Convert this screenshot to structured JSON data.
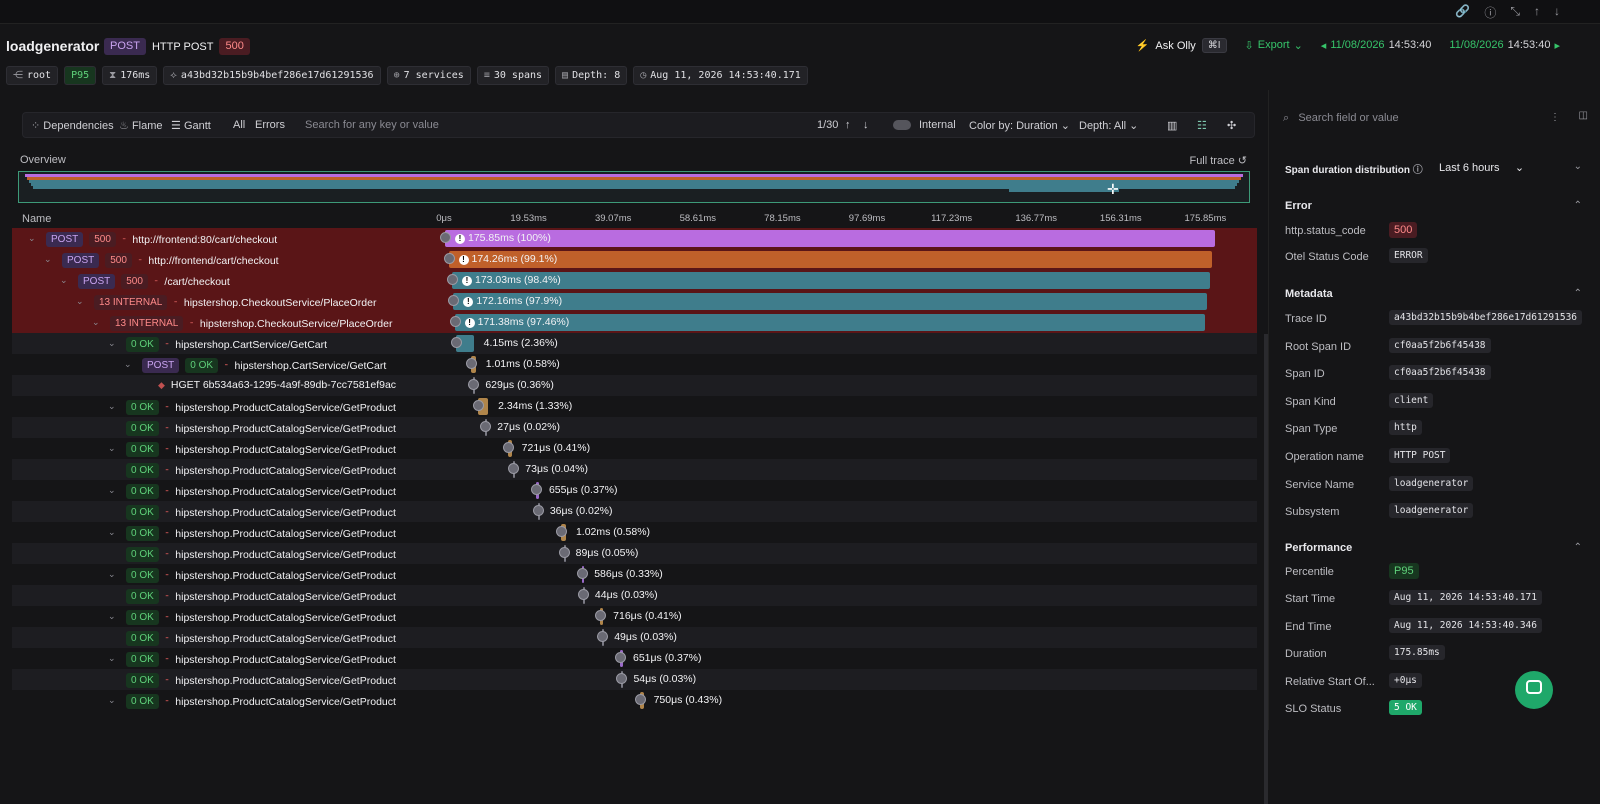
{
  "topicons": [
    "link-icon",
    "info-icon",
    "collapse-icon",
    "arrow-up-icon",
    "arrow-down-icon"
  ],
  "header": {
    "title": "loadgenerator",
    "method": "POST",
    "operation": "HTTP POST",
    "status": "500",
    "ask_olly": "Ask Olly",
    "ask_kbd": "⌘I",
    "export": "Export",
    "date_from": "11/08/2026",
    "time_from": "14:53:40",
    "date_to": "11/08/2026",
    "time_to": "14:53:40"
  },
  "chips": {
    "root": "root",
    "percentile": "P95",
    "duration": "176ms",
    "trace_id": "a43bd32b15b9b4bef286e17d61291536",
    "services": "7 services",
    "spans": "30 spans",
    "depth": "Depth: 8",
    "time": "Aug 11, 2026 14:53:40.171"
  },
  "toolbar": {
    "dependencies": "Dependencies",
    "flame": "Flame",
    "gantt": "Gantt",
    "all": "All",
    "errors": "Errors",
    "search_placeholder": "Search for any key or value",
    "counter": "1/30",
    "internal": "Internal",
    "color_by": "Color by: Duration",
    "depth": "Depth: All"
  },
  "overview": {
    "label": "Overview",
    "full_trace": "Full trace"
  },
  "columns": {
    "name": "Name"
  },
  "ticks": [
    "0μs",
    "19.53ms",
    "39.07ms",
    "58.61ms",
    "78.15ms",
    "97.69ms",
    "117.23ms",
    "136.77ms",
    "156.31ms",
    "175.85ms"
  ],
  "spans": [
    {
      "depth": 0,
      "caret": true,
      "badges": [
        [
          "POST",
          "post"
        ],
        [
          "500",
          "500"
        ]
      ],
      "name": "http://frontend:80/cart/checkout",
      "start": 0,
      "dur": 175.85,
      "label": "175.85ms (100%)",
      "color": "#b96ce0",
      "err": true,
      "exc": true
    },
    {
      "depth": 1,
      "caret": true,
      "badges": [
        [
          "POST",
          "post"
        ],
        [
          "500",
          "500"
        ]
      ],
      "name": "http://frontend/cart/checkout",
      "start": 0.8,
      "dur": 174.26,
      "label": "174.26ms (99.1%)",
      "color": "#c0602a",
      "err": true,
      "exc": true
    },
    {
      "depth": 2,
      "caret": true,
      "badges": [
        [
          "POST",
          "post"
        ],
        [
          "500",
          "500"
        ]
      ],
      "name": "/cart/checkout",
      "start": 1.6,
      "dur": 173.03,
      "label": "173.03ms (98.4%)",
      "color": "#3f7d8c",
      "err": true,
      "exc": true
    },
    {
      "depth": 3,
      "caret": true,
      "badges": [
        [
          "13 INTERNAL",
          "int"
        ]
      ],
      "name": "hipstershop.CheckoutService/PlaceOrder",
      "start": 1.9,
      "dur": 172.16,
      "label": "172.16ms (97.9%)",
      "color": "#3f7d8c",
      "err": true,
      "exc": true
    },
    {
      "depth": 4,
      "caret": true,
      "badges": [
        [
          "13 INTERNAL",
          "int"
        ]
      ],
      "name": "hipstershop.CheckoutService/PlaceOrder",
      "start": 2.2,
      "dur": 171.38,
      "label": "171.38ms (97.46%)",
      "color": "#3f7d8c",
      "err": true,
      "exc": true
    },
    {
      "depth": 5,
      "caret": true,
      "badges": [
        [
          "0 OK",
          "ok"
        ]
      ],
      "name": "hipstershop.CartService/GetCart",
      "start": 2.4,
      "dur": 4.15,
      "label": "4.15ms (2.36%)",
      "color": "#3f7d8c",
      "err": false,
      "exc": false
    },
    {
      "depth": 6,
      "caret": true,
      "badges": [
        [
          "POST",
          "post"
        ],
        [
          "0 OK",
          "ok"
        ]
      ],
      "name": "hipstershop.CartService/GetCart",
      "start": 6.0,
      "dur": 1.01,
      "label": "1.01ms (0.58%)",
      "color": "#b0854a",
      "err": false,
      "exc": false
    },
    {
      "depth": 7,
      "caret": false,
      "badges": [],
      "name": "HGET 6b534a63-1295-4a9f-89db-7cc7581ef9ac",
      "start": 6.3,
      "dur": 0.63,
      "label": "629μs (0.36%)",
      "color": "#7a7a84",
      "err": false,
      "exc": false
    },
    {
      "depth": 5,
      "caret": true,
      "badges": [
        [
          "0 OK",
          "ok"
        ]
      ],
      "name": "hipstershop.ProductCatalogService/GetProduct",
      "start": 7.5,
      "dur": 2.34,
      "label": "2.34ms (1.33%)",
      "color": "#b0854a",
      "err": false,
      "exc": false
    },
    {
      "depth": 5,
      "caret": false,
      "badges": [
        [
          "0 OK",
          "ok"
        ]
      ],
      "name": "hipstershop.ProductCatalogService/GetProduct",
      "start": 9.2,
      "dur": 0.03,
      "label": "27μs (0.02%)",
      "color": "#7a7a84",
      "err": false,
      "exc": false
    },
    {
      "depth": 5,
      "caret": true,
      "badges": [
        [
          "0 OK",
          "ok"
        ]
      ],
      "name": "hipstershop.ProductCatalogService/GetProduct",
      "start": 14.5,
      "dur": 0.72,
      "label": "721μs (0.41%)",
      "color": "#b0854a",
      "err": false,
      "exc": false
    },
    {
      "depth": 5,
      "caret": false,
      "badges": [
        [
          "0 OK",
          "ok"
        ]
      ],
      "name": "hipstershop.ProductCatalogService/GetProduct",
      "start": 15.6,
      "dur": 0.07,
      "label": "73μs (0.04%)",
      "color": "#7a7a84",
      "err": false,
      "exc": false
    },
    {
      "depth": 5,
      "caret": true,
      "badges": [
        [
          "0 OK",
          "ok"
        ]
      ],
      "name": "hipstershop.ProductCatalogService/GetProduct",
      "start": 20.8,
      "dur": 0.66,
      "label": "655μs (0.37%)",
      "color": "#9a6ac8",
      "err": false,
      "exc": false
    },
    {
      "depth": 5,
      "caret": false,
      "badges": [
        [
          "0 OK",
          "ok"
        ]
      ],
      "name": "hipstershop.ProductCatalogService/GetProduct",
      "start": 21.2,
      "dur": 0.04,
      "label": "36μs (0.02%)",
      "color": "#7a7a84",
      "err": false,
      "exc": false
    },
    {
      "depth": 5,
      "caret": true,
      "badges": [
        [
          "0 OK",
          "ok"
        ]
      ],
      "name": "hipstershop.ProductCatalogService/GetProduct",
      "start": 26.6,
      "dur": 1.02,
      "label": "1.02ms (0.58%)",
      "color": "#b0854a",
      "err": false,
      "exc": false
    },
    {
      "depth": 5,
      "caret": false,
      "badges": [
        [
          "0 OK",
          "ok"
        ]
      ],
      "name": "hipstershop.ProductCatalogService/GetProduct",
      "start": 27.1,
      "dur": 0.09,
      "label": "89μs (0.05%)",
      "color": "#7a7a84",
      "err": false,
      "exc": false
    },
    {
      "depth": 5,
      "caret": true,
      "badges": [
        [
          "0 OK",
          "ok"
        ]
      ],
      "name": "hipstershop.ProductCatalogService/GetProduct",
      "start": 31.2,
      "dur": 0.59,
      "label": "586μs (0.33%)",
      "color": "#9a6ac8",
      "err": false,
      "exc": false
    },
    {
      "depth": 5,
      "caret": false,
      "badges": [
        [
          "0 OK",
          "ok"
        ]
      ],
      "name": "hipstershop.ProductCatalogService/GetProduct",
      "start": 31.5,
      "dur": 0.04,
      "label": "44μs (0.03%)",
      "color": "#7a7a84",
      "err": false,
      "exc": false
    },
    {
      "depth": 5,
      "caret": true,
      "badges": [
        [
          "0 OK",
          "ok"
        ]
      ],
      "name": "hipstershop.ProductCatalogService/GetProduct",
      "start": 35.4,
      "dur": 0.72,
      "label": "716μs (0.41%)",
      "color": "#b0854a",
      "err": false,
      "exc": false
    },
    {
      "depth": 5,
      "caret": false,
      "badges": [
        [
          "0 OK",
          "ok"
        ]
      ],
      "name": "hipstershop.ProductCatalogService/GetProduct",
      "start": 35.9,
      "dur": 0.05,
      "label": "49μs (0.03%)",
      "color": "#7a7a84",
      "err": false,
      "exc": false
    },
    {
      "depth": 5,
      "caret": true,
      "badges": [
        [
          "0 OK",
          "ok"
        ]
      ],
      "name": "hipstershop.ProductCatalogService/GetProduct",
      "start": 40.0,
      "dur": 0.65,
      "label": "651μs (0.37%)",
      "color": "#9a6ac8",
      "err": false,
      "exc": false
    },
    {
      "depth": 5,
      "caret": false,
      "badges": [
        [
          "0 OK",
          "ok"
        ]
      ],
      "name": "hipstershop.ProductCatalogService/GetProduct",
      "start": 40.3,
      "dur": 0.05,
      "label": "54μs (0.03%)",
      "color": "#7a7a84",
      "err": false,
      "exc": false
    },
    {
      "depth": 5,
      "caret": true,
      "badges": [
        [
          "0 OK",
          "ok"
        ]
      ],
      "name": "hipstershop.ProductCatalogService/GetProduct",
      "start": 44.6,
      "dur": 0.75,
      "label": "750μs (0.43%)",
      "color": "#b0854a",
      "err": false,
      "exc": false
    }
  ],
  "right": {
    "search_placeholder": "Search field or value",
    "dist_label": "Span duration distribution",
    "dist_range": "Last 6 hours",
    "error_title": "Error",
    "http_status_key": "http.status_code",
    "http_status_val": "500",
    "otel_key": "Otel Status Code",
    "otel_val": "ERROR",
    "meta_title": "Metadata",
    "meta": [
      [
        "Trace ID",
        "a43bd32b15b9b4bef286e17d61291536"
      ],
      [
        "Root Span ID",
        "cf0aa5f2b6f45438"
      ],
      [
        "Span ID",
        "cf0aa5f2b6f45438"
      ],
      [
        "Span Kind",
        "client"
      ],
      [
        "Span Type",
        "http"
      ],
      [
        "Operation name",
        "HTTP POST"
      ],
      [
        "Service Name",
        "loadgenerator"
      ],
      [
        "Subsystem",
        "loadgenerator"
      ]
    ],
    "perf_title": "Performance",
    "perf": [
      [
        "Percentile",
        "P95"
      ],
      [
        "Start Time",
        "Aug 11, 2026 14:53:40.171"
      ],
      [
        "End Time",
        "Aug 11, 2026 14:53:40.346"
      ],
      [
        "Duration",
        "175.85ms"
      ],
      [
        "Relative Start Of...",
        "+0μs"
      ],
      [
        "SLO Status",
        "5 OK"
      ]
    ]
  }
}
